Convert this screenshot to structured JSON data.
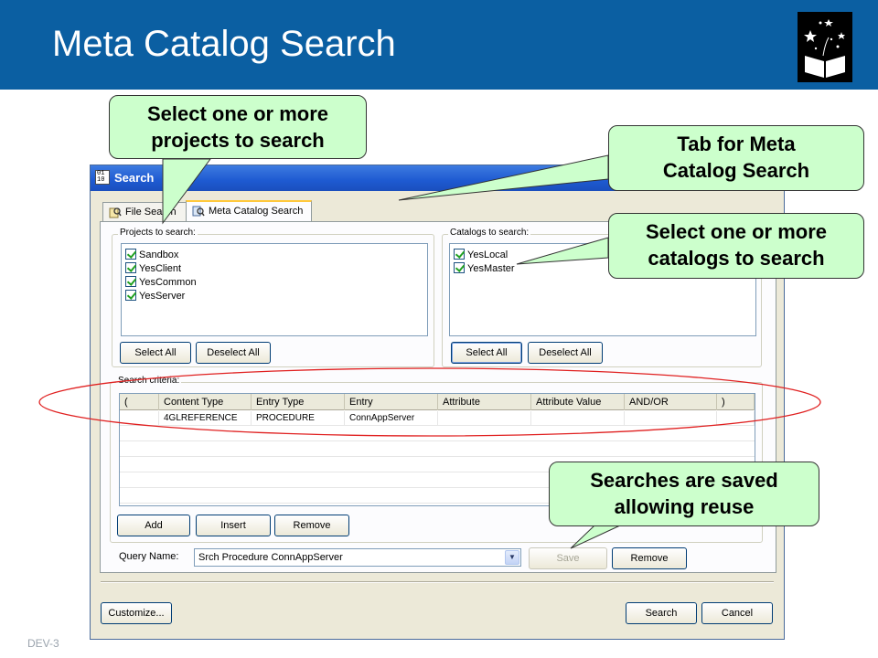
{
  "slide": {
    "title": "Meta Catalog Search",
    "footer": "DEV-3"
  },
  "window": {
    "title": "Search",
    "title_icon_text": "01 10",
    "tabs": [
      {
        "label": "File Search",
        "active": false
      },
      {
        "label": "Meta Catalog Search",
        "active": true
      }
    ],
    "projects": {
      "label": "Projects to search:",
      "items": [
        "Sandbox",
        "YesClient",
        "YesCommon",
        "YesServer"
      ],
      "select_all": "Select All",
      "deselect_all": "Deselect All"
    },
    "catalogs": {
      "label": "Catalogs to search:",
      "items": [
        "YesLocal",
        "YesMaster"
      ],
      "select_all": "Select All",
      "deselect_all": "Deselect All"
    },
    "criteria": {
      "label": "Search criteria:",
      "columns": [
        "(",
        "Content Type",
        "Entry Type",
        "Entry",
        "Attribute",
        "Attribute Value",
        "AND/OR",
        ")"
      ],
      "rows": [
        [
          "",
          "4GLREFERENCE",
          "PROCEDURE",
          "ConnAppServer",
          "",
          "",
          "",
          ""
        ]
      ],
      "add": "Add",
      "insert": "Insert",
      "remove": "Remove"
    },
    "query": {
      "label": "Query Name:",
      "value": "Srch Procedure ConnAppServer",
      "save": "Save",
      "remove": "Remove"
    },
    "footer_buttons": {
      "customize": "Customize...",
      "search": "Search",
      "cancel": "Cancel"
    }
  },
  "callouts": {
    "projects": [
      "Select one or more",
      "projects to search"
    ],
    "tab": [
      "Tab for Meta",
      "Catalog Search"
    ],
    "catalogs": [
      "Select one or more",
      "catalogs to search"
    ],
    "saved": [
      "Searches are saved",
      "allowing reuse"
    ]
  },
  "colors": {
    "header": "#0b5fa2",
    "callout_fill": "#ccffcc",
    "ellipse": "#e02020"
  }
}
